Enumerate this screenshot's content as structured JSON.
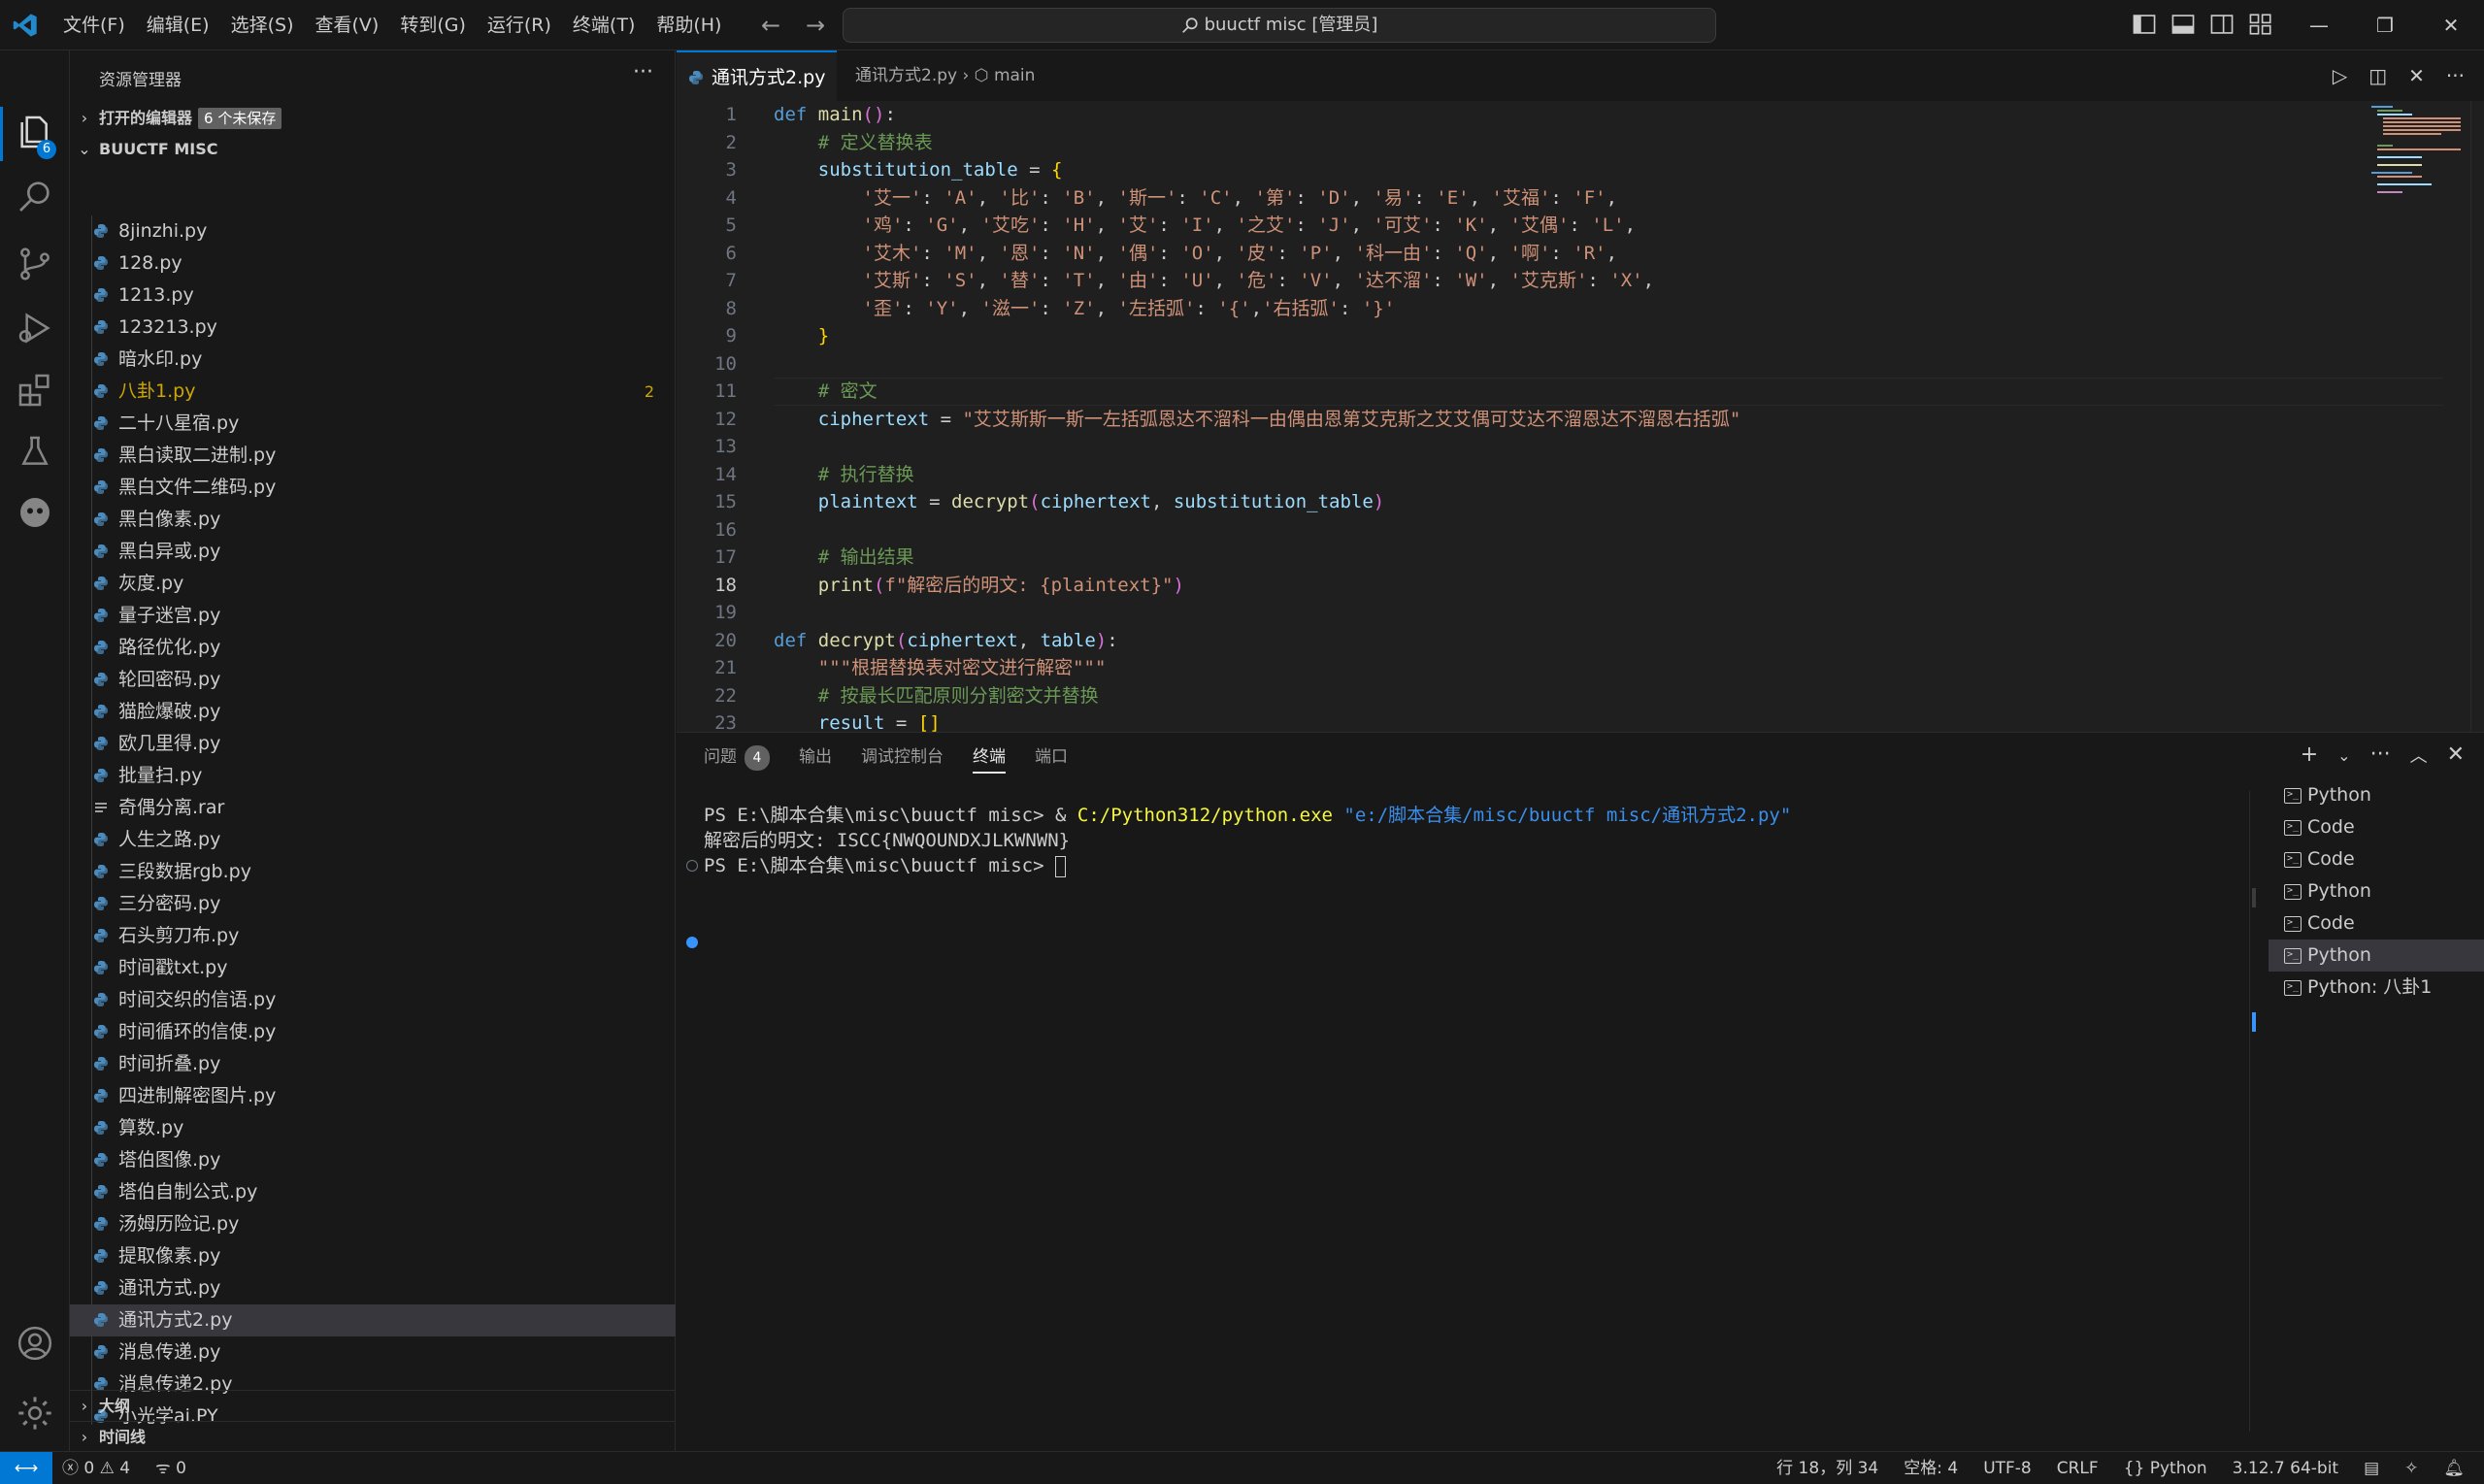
{
  "window": {
    "search_label": "buuctf misc [管理员]"
  },
  "menu": [
    "文件(F)",
    "编辑(E)",
    "选择(S)",
    "查看(V)",
    "转到(G)",
    "运行(R)",
    "终端(T)",
    "帮助(H)"
  ],
  "activity": {
    "explorer_badge": "6"
  },
  "sidebar": {
    "header": "资源管理器",
    "open_editors_label": "打开的编辑器",
    "unsaved_badge": "6 个未保存",
    "folder_label": "BUUCTF MISC",
    "outline_label": "大纲",
    "timeline_label": "时间线",
    "files": [
      {
        "name": "8jinzhi.py"
      },
      {
        "name": "128.py"
      },
      {
        "name": "1213.py"
      },
      {
        "name": "123213.py"
      },
      {
        "name": "暗水印.py"
      },
      {
        "name": "八卦1.py",
        "problems": "2"
      },
      {
        "name": "二十八星宿.py"
      },
      {
        "name": "黑白读取二进制.py"
      },
      {
        "name": "黑白文件二维码.py"
      },
      {
        "name": "黑白像素.py"
      },
      {
        "name": "黑白异或.py"
      },
      {
        "name": "灰度.py"
      },
      {
        "name": "量子迷宫.py"
      },
      {
        "name": "路径优化.py"
      },
      {
        "name": "轮回密码.py"
      },
      {
        "name": "猫脸爆破.py"
      },
      {
        "name": "欧几里得.py"
      },
      {
        "name": "批量扫.py"
      },
      {
        "name": "奇偶分离.rar"
      },
      {
        "name": "人生之路.py"
      },
      {
        "name": "三段数据rgb.py"
      },
      {
        "name": "三分密码.py"
      },
      {
        "name": "石头剪刀布.py"
      },
      {
        "name": "时间戳txt.py"
      },
      {
        "name": "时间交织的信语.py"
      },
      {
        "name": "时间循环的信使.py"
      },
      {
        "name": "时间折叠.py"
      },
      {
        "name": "四进制解密图片.py"
      },
      {
        "name": "算数.py"
      },
      {
        "name": "塔伯图像.py"
      },
      {
        "name": "塔伯自制公式.py"
      },
      {
        "name": "汤姆历险记.py"
      },
      {
        "name": "提取像素.py"
      },
      {
        "name": "通讯方式.py"
      },
      {
        "name": "通讯方式2.py"
      },
      {
        "name": "消息传递.py"
      },
      {
        "name": "消息传递2.py"
      },
      {
        "name": "小光学ai.PY"
      }
    ]
  },
  "editor": {
    "tab_label": "通讯方式2.py",
    "breadcrumb_file": "通讯方式2.py",
    "breadcrumb_symbol": "main",
    "current_line": "18",
    "lines": [
      {
        "n": "1",
        "code": "def main():"
      },
      {
        "n": "2",
        "code": "    # 定义替换表"
      },
      {
        "n": "3",
        "code": "    substitution_table = {"
      },
      {
        "n": "4",
        "code": "        '艾一': 'A', '比': 'B', '斯一': 'C', '第': 'D', '易': 'E', '艾福': 'F',"
      },
      {
        "n": "5",
        "code": "        '鸡': 'G', '艾吃': 'H', '艾': 'I', '之艾': 'J', '可艾': 'K', '艾偶': 'L',"
      },
      {
        "n": "6",
        "code": "        '艾木': 'M', '恩': 'N', '偶': 'O', '皮': 'P', '科一由': 'Q', '啊': 'R',"
      },
      {
        "n": "7",
        "code": "        '艾斯': 'S', '替': 'T', '由': 'U', '危': 'V', '达不溜': 'W', '艾克斯': 'X',"
      },
      {
        "n": "8",
        "code": "        '歪': 'Y', '滋一': 'Z', '左括弧': '{','右括弧': '}'"
      },
      {
        "n": "9",
        "code": "    }"
      },
      {
        "n": "10",
        "code": ""
      },
      {
        "n": "11",
        "code": "    # 密文"
      },
      {
        "n": "12",
        "code": "    ciphertext = \"艾艾斯斯一斯一左括弧恩达不溜科一由偶由恩第艾克斯之艾艾偶可艾达不溜恩达不溜恩右括弧\""
      },
      {
        "n": "13",
        "code": ""
      },
      {
        "n": "14",
        "code": "    # 执行替换"
      },
      {
        "n": "15",
        "code": "    plaintext = decrypt(ciphertext, substitution_table)"
      },
      {
        "n": "16",
        "code": ""
      },
      {
        "n": "17",
        "code": "    # 输出结果"
      },
      {
        "n": "18",
        "code": "    print(f\"解密后的明文: {plaintext}\")"
      },
      {
        "n": "19",
        "code": ""
      },
      {
        "n": "20",
        "code": "def decrypt(ciphertext, table):"
      },
      {
        "n": "21",
        "code": "    \"\"\"根据替换表对密文进行解密\"\"\""
      },
      {
        "n": "22",
        "code": "    # 按最长匹配原则分割密文并替换"
      },
      {
        "n": "23",
        "code": "    result = []"
      }
    ]
  },
  "panel": {
    "tabs": [
      {
        "label": "问题",
        "badge": "4"
      },
      {
        "label": "输出"
      },
      {
        "label": "调试控制台"
      },
      {
        "label": "终端"
      },
      {
        "label": "端口"
      }
    ],
    "terminal": {
      "prompt1": "PS E:\\脚本合集\\misc\\buuctf misc> ",
      "cmd_amp": "& ",
      "cmd_exe": "C:/Python312/python.exe",
      "cmd_arg": " \"e:/脚本合集/misc/buuctf misc/通讯方式2.py\"",
      "output": "解密后的明文: ISCC{NWQOUNDXJLKWNWN}",
      "prompt2": "PS E:\\脚本合集\\misc\\buuctf misc> "
    },
    "terminal_list": [
      "Python",
      "Code",
      "Code",
      "Python",
      "Code",
      "Python",
      "Python: 八卦1"
    ]
  },
  "statusbar": {
    "errors": "0",
    "warnings": "4",
    "ports": "0",
    "position": "行 18，列 34",
    "spaces": "空格: 4",
    "encoding": "UTF-8",
    "eol": "CRLF",
    "language": "Python",
    "interpreter": "3.12.7 64-bit"
  }
}
